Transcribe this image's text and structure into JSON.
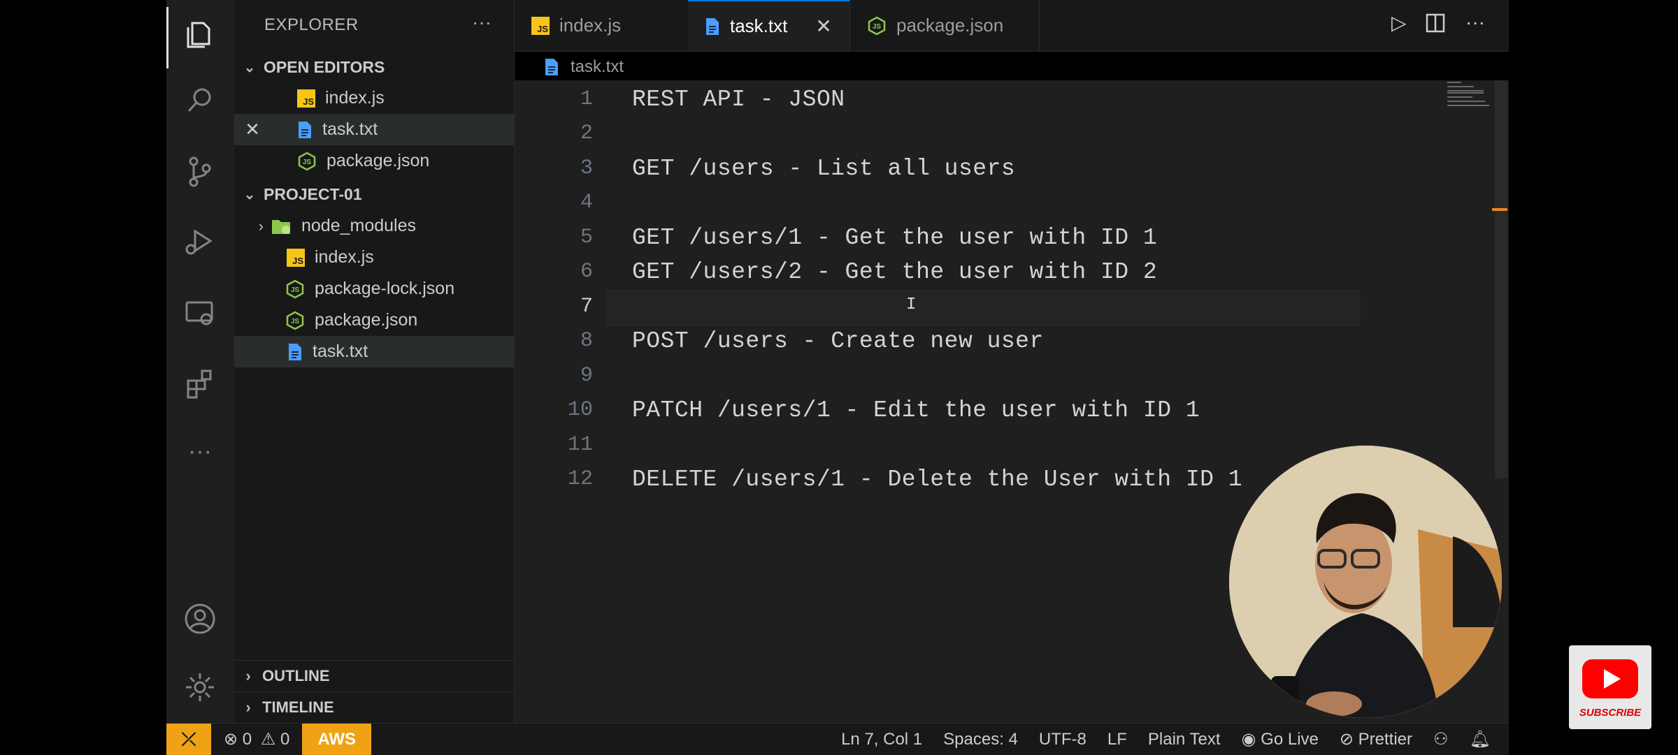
{
  "sidebar": {
    "title": "EXPLORER",
    "open_editors": {
      "header": "OPEN EDITORS",
      "items": [
        {
          "label": "index.js",
          "type": "js"
        },
        {
          "label": "task.txt",
          "type": "txt"
        },
        {
          "label": "package.json",
          "type": "node"
        }
      ]
    },
    "project": {
      "header": "PROJECT-01",
      "items": [
        {
          "label": "node_modules",
          "type": "folder"
        },
        {
          "label": "index.js",
          "type": "js"
        },
        {
          "label": "package-lock.json",
          "type": "node"
        },
        {
          "label": "package.json",
          "type": "node"
        },
        {
          "label": "task.txt",
          "type": "txt"
        }
      ]
    },
    "outline": "OUTLINE",
    "timeline": "TIMELINE"
  },
  "tabs": [
    {
      "label": "index.js",
      "type": "js"
    },
    {
      "label": "task.txt",
      "type": "txt",
      "active": true
    },
    {
      "label": "package.json",
      "type": "node"
    }
  ],
  "breadcrumb": "task.txt",
  "editor": {
    "lines": [
      {
        "n": "1",
        "text": "REST API - JSON"
      },
      {
        "n": "2",
        "text": ""
      },
      {
        "n": "3",
        "text": "GET /users - List all users"
      },
      {
        "n": "4",
        "text": ""
      },
      {
        "n": "5",
        "text": "GET /users/1 - Get the user with ID 1"
      },
      {
        "n": "6",
        "text": "GET /users/2 - Get the user with ID 2"
      },
      {
        "n": "7",
        "text": ""
      },
      {
        "n": "8",
        "text": "POST /users - Create new user"
      },
      {
        "n": "9",
        "text": ""
      },
      {
        "n": "10",
        "text": "PATCH /users/1 - Edit the user with ID 1"
      },
      {
        "n": "11",
        "text": ""
      },
      {
        "n": "12",
        "text": "DELETE /users/1 - Delete the User with ID 1"
      }
    ],
    "current_line": "7"
  },
  "status": {
    "errors": "0",
    "warnings": "0",
    "aws": "AWS",
    "position": "Ln 7, Col 1",
    "spaces": "Spaces: 4",
    "encoding": "UTF-8",
    "eol": "LF",
    "language": "Plain Text",
    "golive": "Go Live",
    "prettier": "Prettier"
  },
  "overlay": {
    "subscribe": "SUBSCRIBE"
  },
  "colors": {
    "accent": "#0078d4",
    "status_warning": "#f0a215",
    "youtube_red": "#ff0000"
  }
}
